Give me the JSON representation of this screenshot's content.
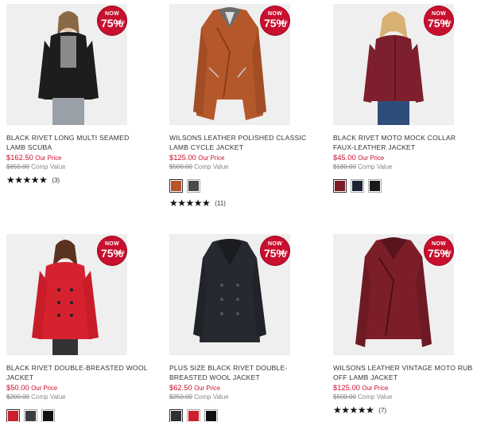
{
  "badge": {
    "now": "NOW",
    "percent": "75%",
    "off": "OFF"
  },
  "products": [
    {
      "title": "BLACK RIVET LONG MULTI SEAMED LAMB SCUBA",
      "price": "$162.50",
      "price_label": "Our Price",
      "comp_price": "$650.00",
      "comp_label": "Comp Value",
      "stars": "★★★★★",
      "review_count": "(3)",
      "swatches": []
    },
    {
      "title": "WILSONS LEATHER POLISHED CLASSIC LAMB CYCLE JACKET",
      "price": "$125.00",
      "price_label": "Our Price",
      "comp_price": "$500.00",
      "comp_label": "Comp Value",
      "stars": "★★★★★",
      "review_count": "(11)",
      "swatches": [
        "#b5552a",
        "#4a4a4a"
      ]
    },
    {
      "title": "BLACK RIVET MOTO MOCK COLLAR FAUX-LEATHER JACKET",
      "price": "$45.00",
      "price_label": "Our Price",
      "comp_price": "$180.00",
      "comp_label": "Comp Value",
      "stars": "",
      "review_count": "",
      "swatches": [
        "#7a1b26",
        "#1c2233",
        "#1a1a1a"
      ]
    },
    {
      "title": "BLACK RIVET DOUBLE-BREASTED WOOL JACKET",
      "price": "$50.00",
      "price_label": "Our Price",
      "comp_price": "$200.00",
      "comp_label": "Comp Value",
      "stars": "",
      "review_count": "",
      "swatches": [
        "#cc1f2e",
        "#3a3c40",
        "#111111"
      ]
    },
    {
      "title": "PLUS SIZE BLACK RIVET DOUBLE-BREASTED WOOL JACKET",
      "price": "$62.50",
      "price_label": "Our Price",
      "comp_price": "$250.00",
      "comp_label": "Comp Value",
      "stars": "",
      "review_count": "",
      "swatches": [
        "#2e3035",
        "#cc1f2e",
        "#111111"
      ]
    },
    {
      "title": "WILSONS LEATHER VINTAGE MOTO RUB OFF LAMB JACKET",
      "price": "$125.00",
      "price_label": "Our Price",
      "comp_price": "$500.00",
      "comp_label": "Comp Value",
      "stars": "★★★★★",
      "review_count": "(7)",
      "swatches": []
    }
  ]
}
